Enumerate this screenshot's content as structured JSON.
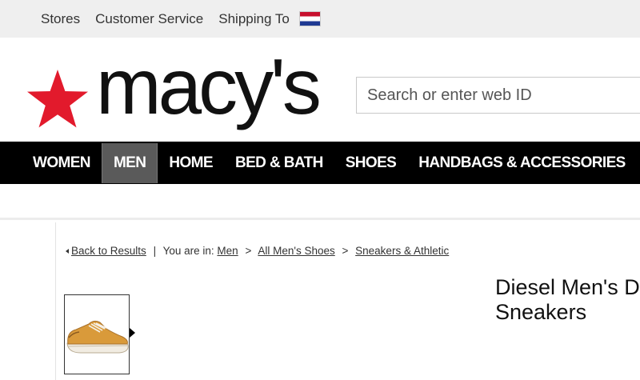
{
  "utility_bar": {
    "stores": "Stores",
    "customer_service": "Customer Service",
    "shipping_to": "Shipping To",
    "flag_icon": "netherlands-flag-icon"
  },
  "header": {
    "logo_text": "macy's",
    "logo_star_color": "#e21a2c",
    "search_placeholder": "Search or enter web ID"
  },
  "nav": {
    "items": [
      {
        "label": "WOMEN",
        "active": false
      },
      {
        "label": "MEN",
        "active": true
      },
      {
        "label": "HOME",
        "active": false
      },
      {
        "label": "BED & BATH",
        "active": false
      },
      {
        "label": "SHOES",
        "active": false
      },
      {
        "label": "HANDBAGS & ACCESSORIES",
        "active": false
      }
    ]
  },
  "breadcrumb": {
    "back": "Back to Results",
    "separator": "|",
    "you_are_in": "You are in:",
    "crumbs": [
      "Men",
      "All Men's Shoes",
      "Sneakers & Athletic"
    ],
    "arrow": ">"
  },
  "product": {
    "title_line1": "Diesel Men's D",
    "title_line2": "Sneakers",
    "thumbnail_icon": "tan-sneaker-image"
  }
}
